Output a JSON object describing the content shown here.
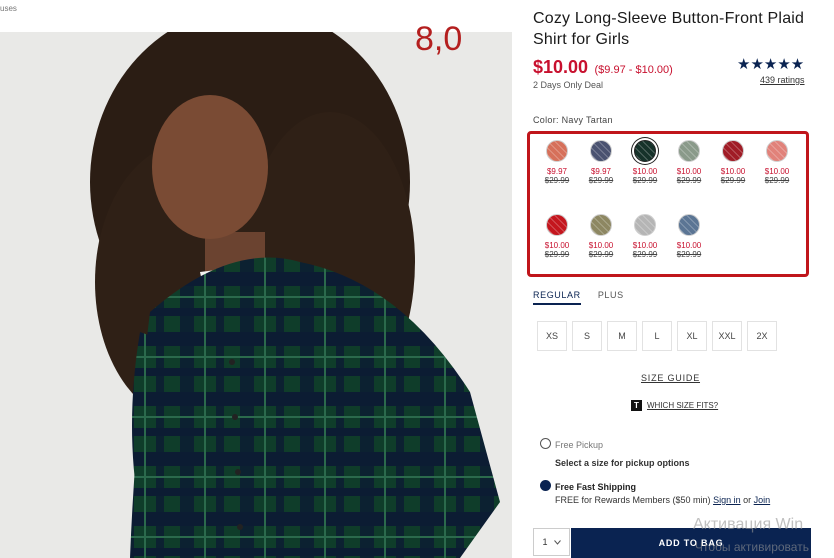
{
  "breadcrumb": "uses",
  "annotation": "8,0",
  "product": {
    "title": "Cozy Long-Sleeve Button-Front Plaid Shirt for Girls",
    "price": "$10.00",
    "price_range": "($9.97 - $10.00)",
    "deal": "2 Days Only Deal",
    "stars": "★★★★★",
    "ratings": "439 ratings"
  },
  "color": {
    "label": "Color:",
    "selected": "Navy Tartan"
  },
  "swatches": [
    {
      "sale": "$9.97",
      "orig": "$29.99",
      "color": "#d6705a",
      "selected": false
    },
    {
      "sale": "$9.97",
      "orig": "$29.99",
      "color": "#4a5270",
      "selected": false
    },
    {
      "sale": "$10.00",
      "orig": "$29.99",
      "color": "#16322a",
      "selected": true
    },
    {
      "sale": "$10.00",
      "orig": "$29.99",
      "color": "#8a9a8a",
      "selected": false
    },
    {
      "sale": "$10.00",
      "orig": "$29.99",
      "color": "#a01c26",
      "selected": false
    },
    {
      "sale": "$10.00",
      "orig": "$29.99",
      "color": "#e1827a",
      "selected": false
    },
    {
      "sale": "$10.00",
      "orig": "$29.99",
      "color": "#c4161e",
      "selected": false
    },
    {
      "sale": "$10.00",
      "orig": "$29.99",
      "color": "#8d8762",
      "selected": false
    },
    {
      "sale": "$10.00",
      "orig": "$29.99",
      "color": "#b5b5b5",
      "selected": false
    },
    {
      "sale": "$10.00",
      "orig": "$29.99",
      "color": "#5b7594",
      "selected": false
    }
  ],
  "size_tabs": [
    "REGULAR",
    "PLUS"
  ],
  "sizes": [
    "XS",
    "S",
    "M",
    "L",
    "XL",
    "XXL",
    "2X"
  ],
  "size_guide": "SIZE GUIDE",
  "which_fits": "WHICH SIZE FITS?",
  "fit_icon_letter": "T",
  "pickup": {
    "label": "Free Pickup",
    "sub": "Select a size for pickup options"
  },
  "shipping": {
    "label": "Free Fast Shipping",
    "sub_prefix": "FREE for Rewards Members ($50 min)",
    "sign_in": "Sign in",
    "or": "or",
    "join": "Join"
  },
  "qty": "1",
  "add_to_bag": "ADD TO BAG",
  "watermark": {
    "line1": "Активация Win",
    "line2": "Чтобы активировать"
  },
  "colors": {
    "brand_navy": "#0a2351",
    "sale_red": "#c8102e",
    "highlight_red": "#c0151b"
  }
}
